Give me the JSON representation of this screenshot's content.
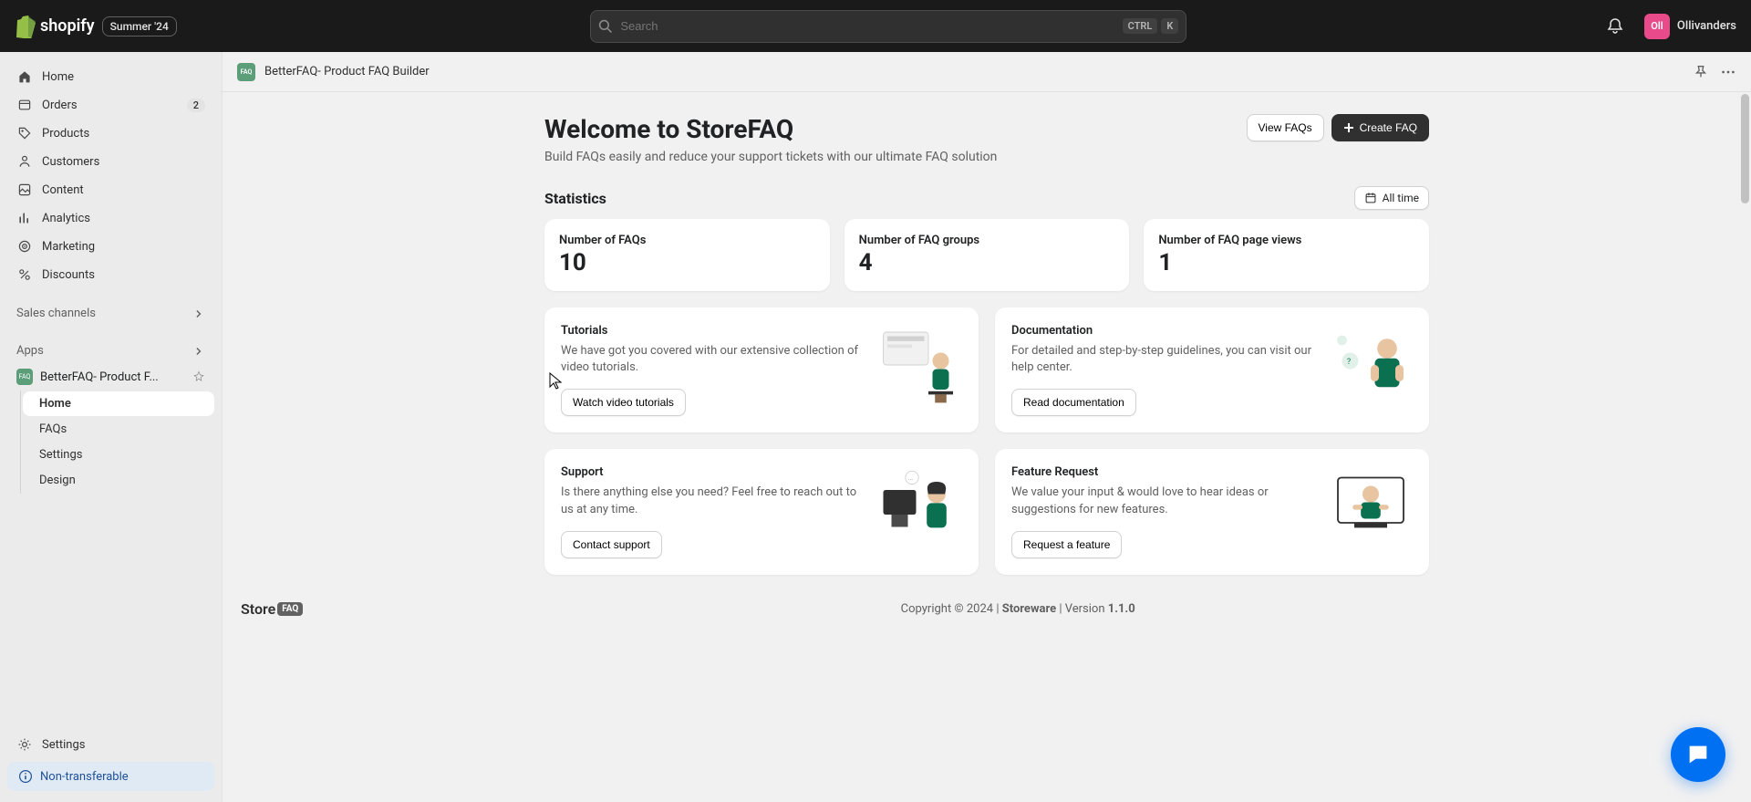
{
  "topbar": {
    "brand": "shopify",
    "badge": "Summer '24",
    "search_placeholder": "Search",
    "kbd1": "CTRL",
    "kbd2": "K",
    "avatar_initials": "Oll",
    "username": "Ollivanders"
  },
  "sidebar": {
    "items": [
      {
        "label": "Home"
      },
      {
        "label": "Orders",
        "badge": "2"
      },
      {
        "label": "Products"
      },
      {
        "label": "Customers"
      },
      {
        "label": "Content"
      },
      {
        "label": "Analytics"
      },
      {
        "label": "Marketing"
      },
      {
        "label": "Discounts"
      }
    ],
    "sales_channels_label": "Sales channels",
    "apps_label": "Apps",
    "app_name": "BetterFAQ- Product F...",
    "app_sub": [
      {
        "label": "Home"
      },
      {
        "label": "FAQs"
      },
      {
        "label": "Settings"
      },
      {
        "label": "Design"
      }
    ],
    "settings_label": "Settings",
    "non_transferable": "Non-transferable"
  },
  "header": {
    "app_title": "BetterFAQ- Product FAQ Builder"
  },
  "main": {
    "welcome": "Welcome to StoreFAQ",
    "subtitle": "Build FAQs easily and reduce your support tickets with our ultimate FAQ solution",
    "view_faqs": "View FAQs",
    "create_faq": "Create FAQ",
    "stats_heading": "Statistics",
    "all_time": "All time",
    "stats": [
      {
        "label": "Number of FAQs",
        "value": "10"
      },
      {
        "label": "Number of FAQ groups",
        "value": "4"
      },
      {
        "label": "Number of FAQ page views",
        "value": "1"
      }
    ],
    "cards": {
      "tutorials": {
        "title": "Tutorials",
        "desc": "We have got you covered with our extensive collection of video tutorials.",
        "btn": "Watch video tutorials"
      },
      "documentation": {
        "title": "Documentation",
        "desc": "For detailed and step-by-step guidelines, you can visit our help center.",
        "btn": "Read documentation"
      },
      "support": {
        "title": "Support",
        "desc": "Is there anything else you need? Feel free to reach out to us at any time.",
        "btn": "Contact support"
      },
      "feature": {
        "title": "Feature Request",
        "desc": "We value your input & would love to hear ideas or suggestions for new features.",
        "btn": "Request a feature"
      }
    }
  },
  "footer": {
    "logo1": "Store",
    "logo2": "FAQ",
    "copyright_pre": "Copyright © 2024 | ",
    "company": "Storeware",
    "version_pre": " | Version ",
    "version": "1.1.0"
  }
}
